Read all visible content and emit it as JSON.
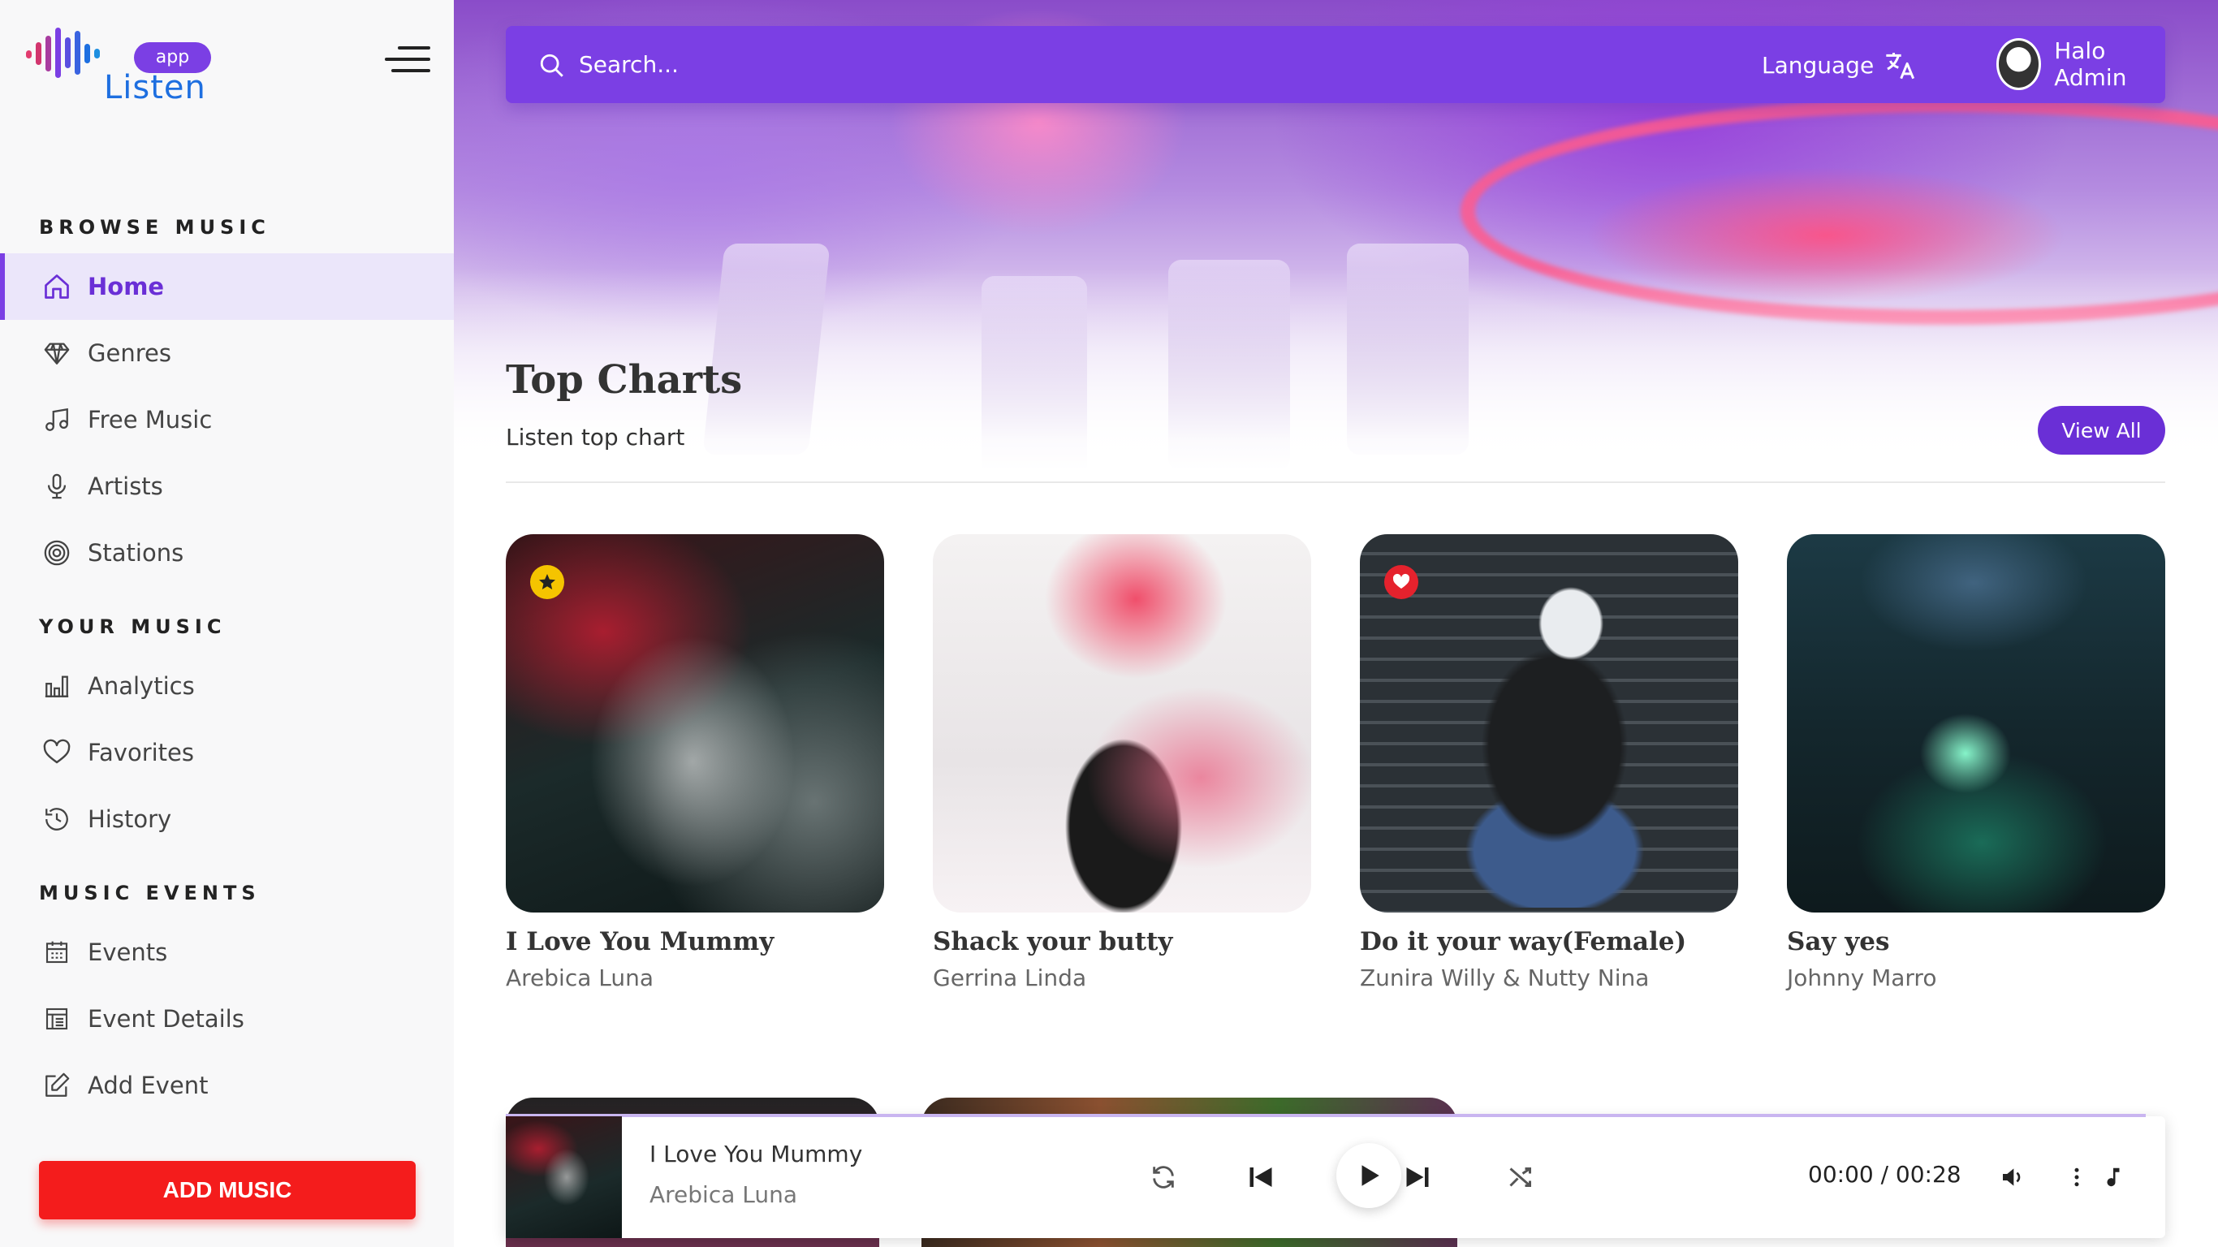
{
  "app": {
    "logo_badge": "app",
    "logo_text": "Listen"
  },
  "sidebar": {
    "sections": [
      {
        "title": "BROWSE MUSIC"
      },
      {
        "title": "YOUR MUSIC"
      },
      {
        "title": "MUSIC EVENTS"
      }
    ],
    "items": [
      {
        "label": "Home",
        "icon": "home-icon",
        "active": true
      },
      {
        "label": "Genres",
        "icon": "diamond-icon"
      },
      {
        "label": "Free Music",
        "icon": "music-note-icon"
      },
      {
        "label": "Artists",
        "icon": "microphone-icon"
      },
      {
        "label": "Stations",
        "icon": "radio-target-icon"
      },
      {
        "label": "Analytics",
        "icon": "bar-chart-icon"
      },
      {
        "label": "Favorites",
        "icon": "heart-icon"
      },
      {
        "label": "History",
        "icon": "history-icon"
      },
      {
        "label": "Events",
        "icon": "calendar-icon"
      },
      {
        "label": "Event Details",
        "icon": "event-details-icon"
      },
      {
        "label": "Add Event",
        "icon": "edit-icon"
      }
    ],
    "add_music_label": "ADD MUSIC"
  },
  "header": {
    "search_placeholder": "Search...",
    "language_label": "Language",
    "user_name": "Halo Admin"
  },
  "hero": {
    "title": "Top Charts",
    "subtitle": "Listen top chart",
    "view_all_label": "View All"
  },
  "cards": [
    {
      "title": "I Love You Mummy",
      "artist": "Arebica Luna",
      "badge": "star"
    },
    {
      "title": "Shack your butty",
      "artist": "Gerrina Linda",
      "badge": ""
    },
    {
      "title": "Do it your way(Female)",
      "artist": "Zunira Willy & Nutty Nina",
      "badge": "heart"
    },
    {
      "title": "Say yes",
      "artist": "Johnny Marro",
      "badge": ""
    }
  ],
  "player": {
    "title": "I Love You Mummy",
    "artist": "Arebica Luna",
    "time": "00:00 / 00:28",
    "accent": "#7b3fe4"
  },
  "colors": {
    "accent": "#7b3fe4",
    "add_music": "#f41c1c",
    "logo_text": "#1e6fe0"
  }
}
